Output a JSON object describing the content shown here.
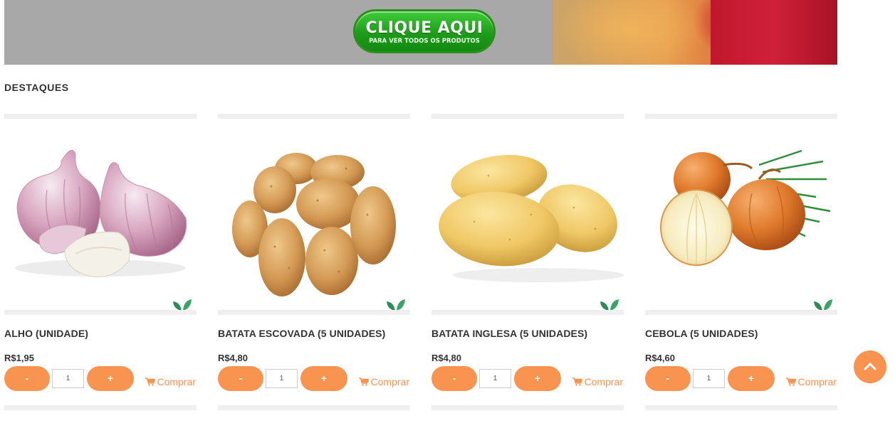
{
  "banner": {
    "cta_main": "CLIQUE AQUI",
    "cta_sub": "PARA VER TODOS OS PRODUTOS"
  },
  "section": {
    "title": "DESTAQUES"
  },
  "products": [
    {
      "name": "ALHO (UNIDADE)",
      "price": "R$1,95",
      "quantity": "1",
      "image": "garlic-image"
    },
    {
      "name": "BATATA ESCOVADA (5 UNIDADES)",
      "price": "R$4,80",
      "quantity": "1",
      "image": "brushed-potatoes-image"
    },
    {
      "name": "BATATA INGLESA (5 UNIDADES)",
      "price": "R$4,80",
      "quantity": "1",
      "image": "english-potatoes-image"
    },
    {
      "name": "CEBOLA (5 UNIDADES)",
      "price": "R$4,60",
      "quantity": "1",
      "image": "onions-image"
    }
  ],
  "controls": {
    "minus_label": "-",
    "plus_label": "+",
    "buy_label": "Comprar"
  },
  "icons": {
    "organic": "leaf-icon",
    "cart": "cart-icon",
    "scroll_top": "chevron-up-icon"
  },
  "colors": {
    "accent": "#f99350",
    "cta_green": "#1e9c1a",
    "leaf": "#2e8b57",
    "text": "#333333"
  }
}
